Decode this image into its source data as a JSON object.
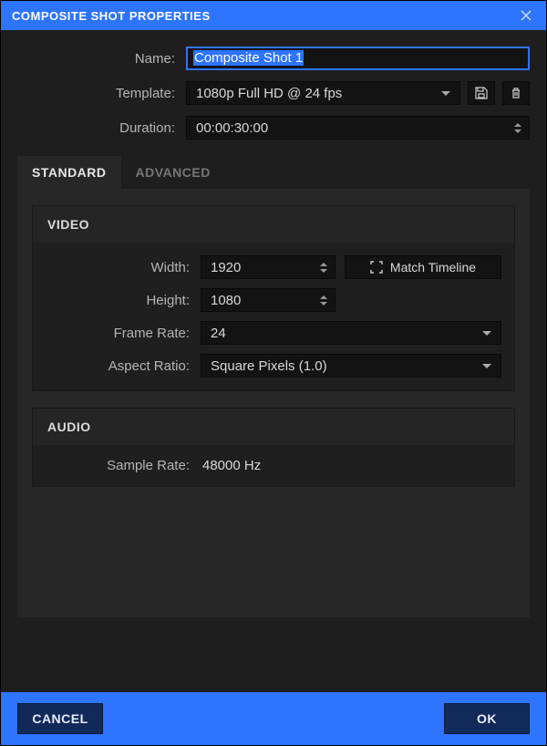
{
  "titlebar": {
    "title": "COMPOSITE SHOT PROPERTIES"
  },
  "form": {
    "name_label": "Name:",
    "name_value": "Composite Shot 1",
    "template_label": "Template:",
    "template_value": "1080p Full HD @ 24 fps",
    "duration_label": "Duration:",
    "duration_value": "00:00:30:00"
  },
  "tabs": {
    "standard": "STANDARD",
    "advanced": "ADVANCED"
  },
  "video": {
    "header": "VIDEO",
    "width_label": "Width:",
    "width_value": "1920",
    "height_label": "Height:",
    "height_value": "1080",
    "match_timeline": "Match Timeline",
    "framerate_label": "Frame Rate:",
    "framerate_value": "24",
    "aspect_label": "Aspect Ratio:",
    "aspect_value": "Square Pixels (1.0)"
  },
  "audio": {
    "header": "AUDIO",
    "samplerate_label": "Sample Rate:",
    "samplerate_value": "48000 Hz"
  },
  "footer": {
    "cancel": "CANCEL",
    "ok": "OK"
  }
}
